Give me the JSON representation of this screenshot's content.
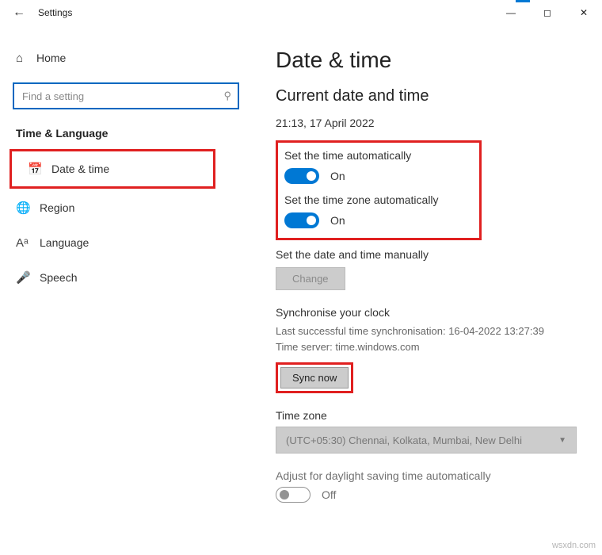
{
  "window": {
    "title": "Settings"
  },
  "sidebar": {
    "home": "Home",
    "search_placeholder": "Find a setting",
    "section": "Time & Language",
    "items": [
      {
        "label": "Date & time"
      },
      {
        "label": "Region"
      },
      {
        "label": "Language"
      },
      {
        "label": "Speech"
      }
    ]
  },
  "content": {
    "title": "Date & time",
    "currentTitle": "Current date and time",
    "currentValue": "21:13, 17 April 2022",
    "autoTimeLabel": "Set the time automatically",
    "autoTimeState": "On",
    "autoTzLabel": "Set the time zone automatically",
    "autoTzState": "On",
    "manualLabel": "Set the date and time manually",
    "changeBtn": "Change",
    "syncTitle": "Synchronise your clock",
    "syncLast": "Last successful time synchronisation: 16-04-2022 13:27:39",
    "syncServer": "Time server: time.windows.com",
    "syncBtn": "Sync now",
    "tzTitle": "Time zone",
    "tzValue": "(UTC+05:30) Chennai, Kolkata, Mumbai, New Delhi",
    "dstLabel": "Adjust for daylight saving time automatically",
    "dstState": "Off"
  },
  "watermark": "wsxdn.com"
}
